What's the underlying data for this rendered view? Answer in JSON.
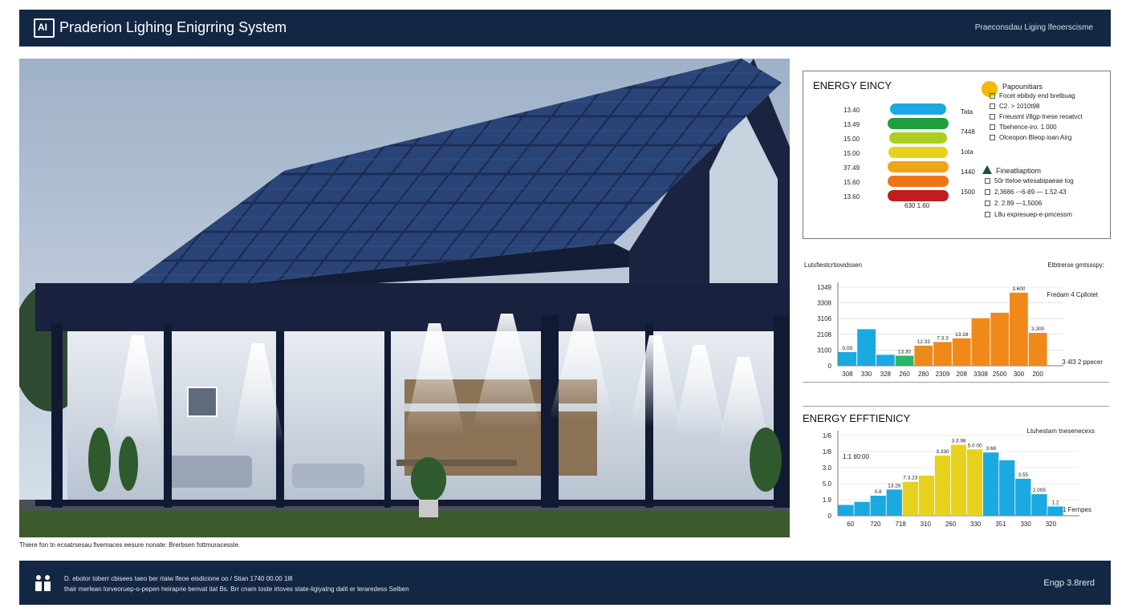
{
  "header": {
    "title": "Praderion Lighing Enigrring System",
    "logo_text": "AI",
    "right_text": "Praeconsdau Liging lfeoerscisme"
  },
  "photo_caption": "Thiere fon tn ecsatrsesau fivemaces eesure nonate: Brerbsen fottmuracessle.",
  "energy_panel": {
    "title": "ENERGY EINCY",
    "scale_left": [
      "13.40",
      "13.49",
      "15.00",
      "15.00",
      "37.49",
      "15.60",
      "13.60"
    ],
    "scale_right": [
      "Tata",
      "7448",
      "1ota",
      "1440",
      "1500"
    ],
    "scale_bottom": "630    1.60",
    "bars": [
      {
        "color": "#1aa9e0"
      },
      {
        "color": "#1e9e3e"
      },
      {
        "color": "#aacf1e"
      },
      {
        "color": "#e6d21c"
      },
      {
        "color": "#f0a418"
      },
      {
        "color": "#ef7418"
      },
      {
        "color": "#c01e1e"
      }
    ],
    "legend1": {
      "title": "Papounitiars",
      "items": [
        "Focet ebibdy end brelbuag",
        "C2. > 1010t98",
        "Frieusmt i/8gp-tnese reoatvct",
        "Tbehence-iro. 1.000",
        "Olceopon Bleop ioan Airg"
      ]
    },
    "legend2": {
      "title": "Fineatliaptiom",
      "items": [
        "50r tteloe-wtesabipaeae tog",
        "2,3686 -~6-89 — 1.52-43",
        "2. 2.89   —1,5006",
        "L8u expresuep-e-pmcessm"
      ]
    }
  },
  "chart_top": {
    "left_title": "Lutsfiestcrtiovidssen",
    "right_title": "Etbtrerse gmtssspy:",
    "legend_text": "Fredam 4 Cpllotet",
    "extra_text": "3  4l3   2 ppecer",
    "yticks": [
      "1349",
      "3308",
      "3106",
      "2108",
      "3100",
      "0"
    ]
  },
  "chart_bottom": {
    "title": "ENERGY EFFTIENICY",
    "right_title": "Ltuhestam tnesenecexs",
    "legend_text": "1:1 tl0:00",
    "extra_text": "+, 1 Fernpes",
    "yticks": [
      "1/6",
      "1/8",
      "3.0",
      "5.0",
      "1.9",
      "0"
    ]
  },
  "chart_data": [
    {
      "type": "bar",
      "title": "",
      "categories": [
        "308",
        "330",
        "328",
        "260",
        "280",
        "2309",
        "208",
        "3308",
        "2500",
        "300",
        "200"
      ],
      "values": [
        1.5,
        4.0,
        1.2,
        1.1,
        2.2,
        2.6,
        3.0,
        5.2,
        5.8,
        8.0,
        3.6
      ],
      "value_labels": [
        "0.00",
        "",
        "",
        "13.30",
        "12.33",
        "7.3.3",
        "13.18",
        "",
        "",
        "3.600",
        "3.300"
      ],
      "colors": [
        "#1aa9e0",
        "#1aa9e0",
        "#1aa9e0",
        "#2bb56a",
        "#ef8a1a",
        "#ef8a1a",
        "#ef8a1a",
        "#ef8a1a",
        "#ef8a1a",
        "#ef8a1a",
        "#ef8a1a"
      ],
      "ylim": [
        0,
        8.6
      ],
      "grid": true
    },
    {
      "type": "bar",
      "title": "",
      "categories": [
        "60",
        "720",
        "718",
        "310",
        "260",
        "330",
        "351",
        "330",
        "320"
      ],
      "values": [
        0.7,
        0.9,
        1.3,
        1.7,
        2.2,
        2.6,
        3.9,
        4.6,
        4.3,
        4.1,
        3.6,
        2.4,
        1.4,
        0.6
      ],
      "value_labels": [
        "",
        "",
        "0.8",
        "13.28",
        "7.3.23",
        "",
        "3.330",
        "3.3.98",
        "5.0 00",
        "3.68",
        "",
        "3.55",
        "2.005",
        "1.2"
      ],
      "colors": [
        "#1aa9e0",
        "#1aa9e0",
        "#1aa9e0",
        "#1aa9e0",
        "#e6d21c",
        "#e6d21c",
        "#e6d21c",
        "#e6d21c",
        "#e6d21c",
        "#1aa9e0",
        "#1aa9e0",
        "#1aa9e0",
        "#1aa9e0",
        "#1aa9e0"
      ],
      "ylim": [
        0,
        5.2
      ],
      "grid": true
    }
  ],
  "footer": {
    "line1": "D. ebotor toberr cbisees taeo ber rtaiw lfeoe eisdicione oo / Stian 1740 00.00 1l8",
    "line2": "thair merlean lorveoruep-o-pepen heiraprie benvat itat Bs. Brr cnam toste irtoves state-ligiyatng dalit er leraredess Selben",
    "right": "Engp 3.8rerd"
  }
}
